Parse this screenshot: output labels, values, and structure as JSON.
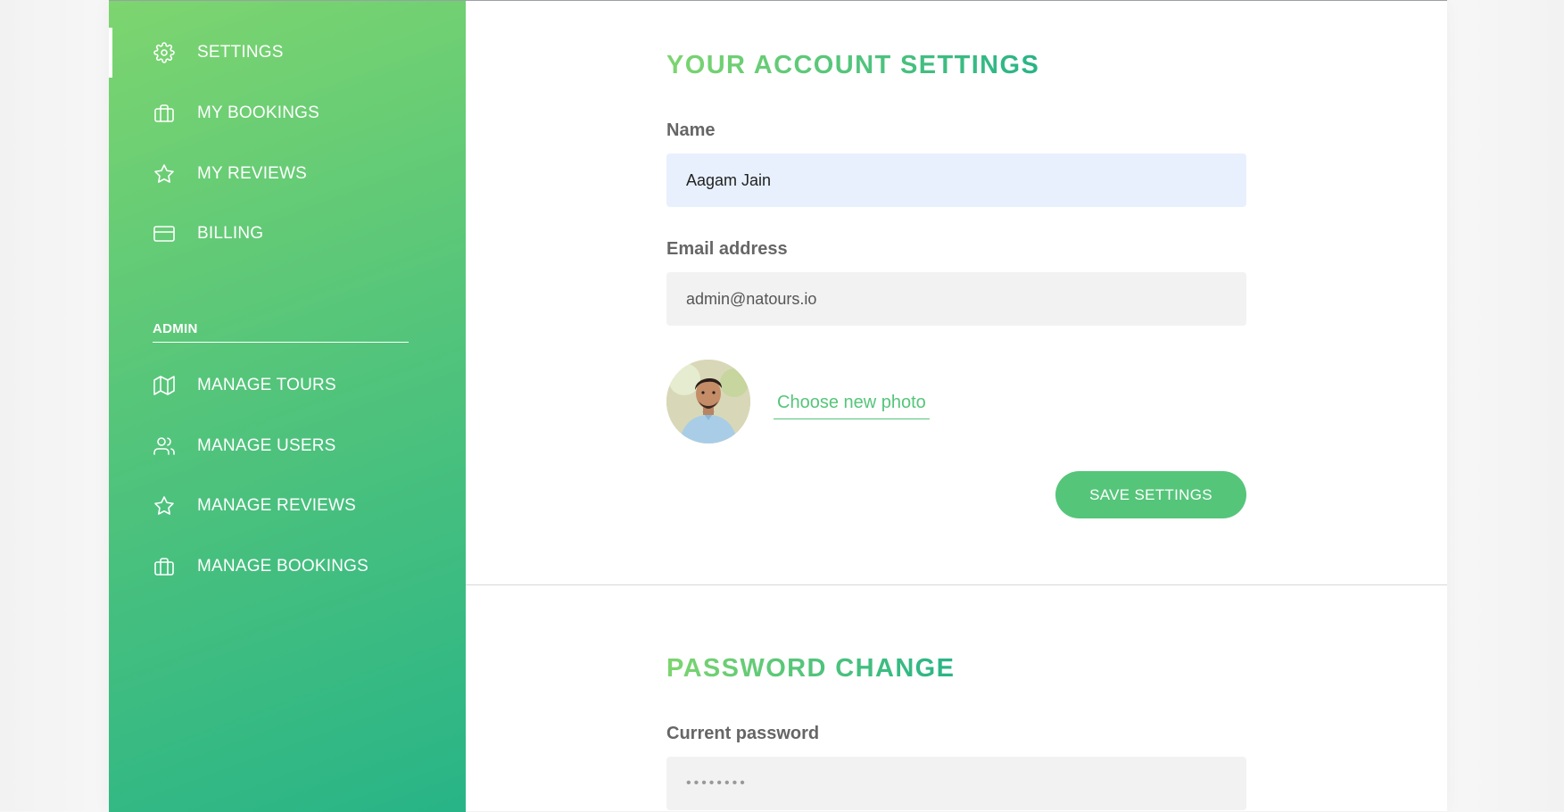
{
  "sidebar": {
    "items": [
      {
        "label": "Settings",
        "icon": "gear-icon",
        "active": true
      },
      {
        "label": "My bookings",
        "icon": "briefcase-icon"
      },
      {
        "label": "My reviews",
        "icon": "star-icon"
      },
      {
        "label": "Billing",
        "icon": "credit-card-icon"
      }
    ],
    "admin_heading": "Admin",
    "admin_items": [
      {
        "label": "Manage tours",
        "icon": "map-icon"
      },
      {
        "label": "Manage users",
        "icon": "users-icon"
      },
      {
        "label": "Manage reviews",
        "icon": "star-icon"
      },
      {
        "label": "Manage bookings",
        "icon": "briefcase-icon"
      }
    ]
  },
  "account": {
    "title": "Your account settings",
    "name_label": "Name",
    "name_value": "Aagam Jain",
    "email_label": "Email address",
    "email_value": "admin@natours.io",
    "photo_link": "Choose new photo",
    "save_button": "Save settings"
  },
  "password": {
    "title": "Password change",
    "current_label": "Current password",
    "current_value": "••••••••"
  },
  "colors": {
    "accent": "#55c57a",
    "gradient_start": "#7dd56f",
    "gradient_end": "#28b487"
  }
}
